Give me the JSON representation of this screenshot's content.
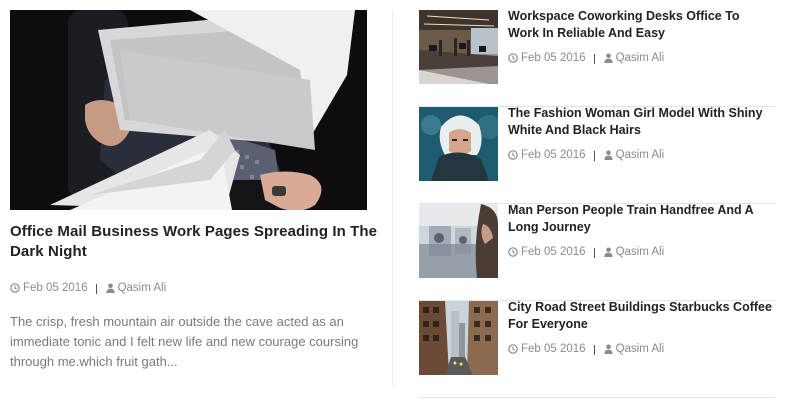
{
  "featured": {
    "title": "Office Mail Business Work Pages Spreading In The Dark Night",
    "date": "Feb 05 2016",
    "author": "Qasim Ali",
    "excerpt": "The crisp, fresh mountain air outside the cave acted as an immediate tonic and I felt new life and new courage coursing through me.which fruit gath..."
  },
  "posts": [
    {
      "title": "Workspace Coworking Desks Office To Work In Reliable And Easy",
      "date": "Feb 05 2016",
      "author": "Qasim Ali"
    },
    {
      "title": "The Fashion Woman Girl Model With Shiny White And Black Hairs",
      "date": "Feb 05 2016",
      "author": "Qasim Ali"
    },
    {
      "title": "Man Person People Train Handfree And A Long Journey",
      "date": "Feb 05 2016",
      "author": "Qasim Ali"
    },
    {
      "title": "City Road Street Buildings Starbucks Coffee For Everyone",
      "date": "Feb 05 2016",
      "author": "Qasim Ali"
    }
  ],
  "icons": {
    "date": "clock-icon",
    "author": "user-icon"
  },
  "colors": {
    "title": "#222222",
    "meta": "#8b8b8b",
    "excerpt": "#7a7a7a",
    "divider": "#e4e4e4"
  }
}
